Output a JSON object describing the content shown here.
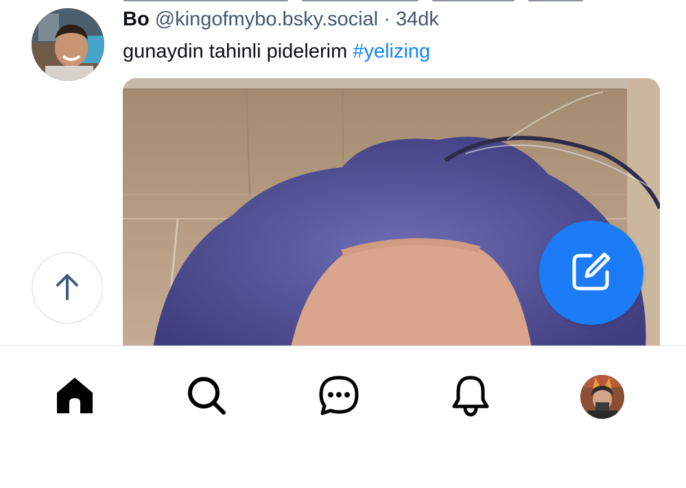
{
  "post": {
    "author": {
      "display_name": "Bo",
      "handle": "@kingofmybo.bsky.social",
      "separator": "·",
      "timestamp": "34dk"
    },
    "text": "gunaydin tahinli pidelerim",
    "hashtag": "#yelizing",
    "image_icon": "photo-purple-hair-selfie"
  },
  "floating": {
    "scroll_top_icon": "arrow-up-icon",
    "compose_icon": "compose-icon"
  },
  "bottom_nav": {
    "items": [
      {
        "icon": "home-icon",
        "active": true
      },
      {
        "icon": "search-icon"
      },
      {
        "icon": "chat-icon"
      },
      {
        "icon": "bell-icon"
      },
      {
        "icon": "profile-avatar"
      }
    ]
  },
  "colors": {
    "accent": "#1c7cf8",
    "hashtag": "#1083fe",
    "muted_text": "#42576c",
    "border": "#d9dfe5"
  }
}
